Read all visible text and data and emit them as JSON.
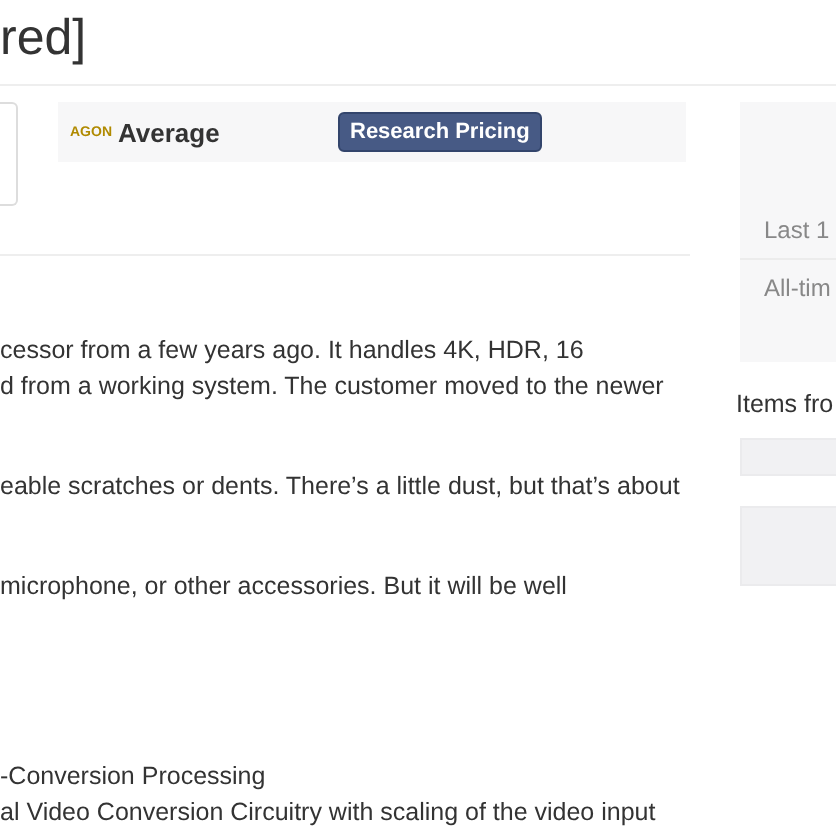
{
  "title": "red]",
  "pricing": {
    "badge": "AGON",
    "rating": "Average",
    "button": "Research Pricing"
  },
  "description": [
    [
      "cessor from a few years ago.  It handles 4K, HDR, 16",
      "d from a working system. The customer moved to the newer"
    ],
    [
      "eable scratches or dents. There’s a little dust, but that’s about"
    ],
    [
      "microphone, or other accessories. But it will be well"
    ]
  ],
  "features": [
    "-Conversion Processing",
    "al Video Conversion Circuitry with scaling of the video input"
  ],
  "sidebar": {
    "stats": [
      "Last 1",
      "All-tim"
    ],
    "heading": "Items fro"
  }
}
